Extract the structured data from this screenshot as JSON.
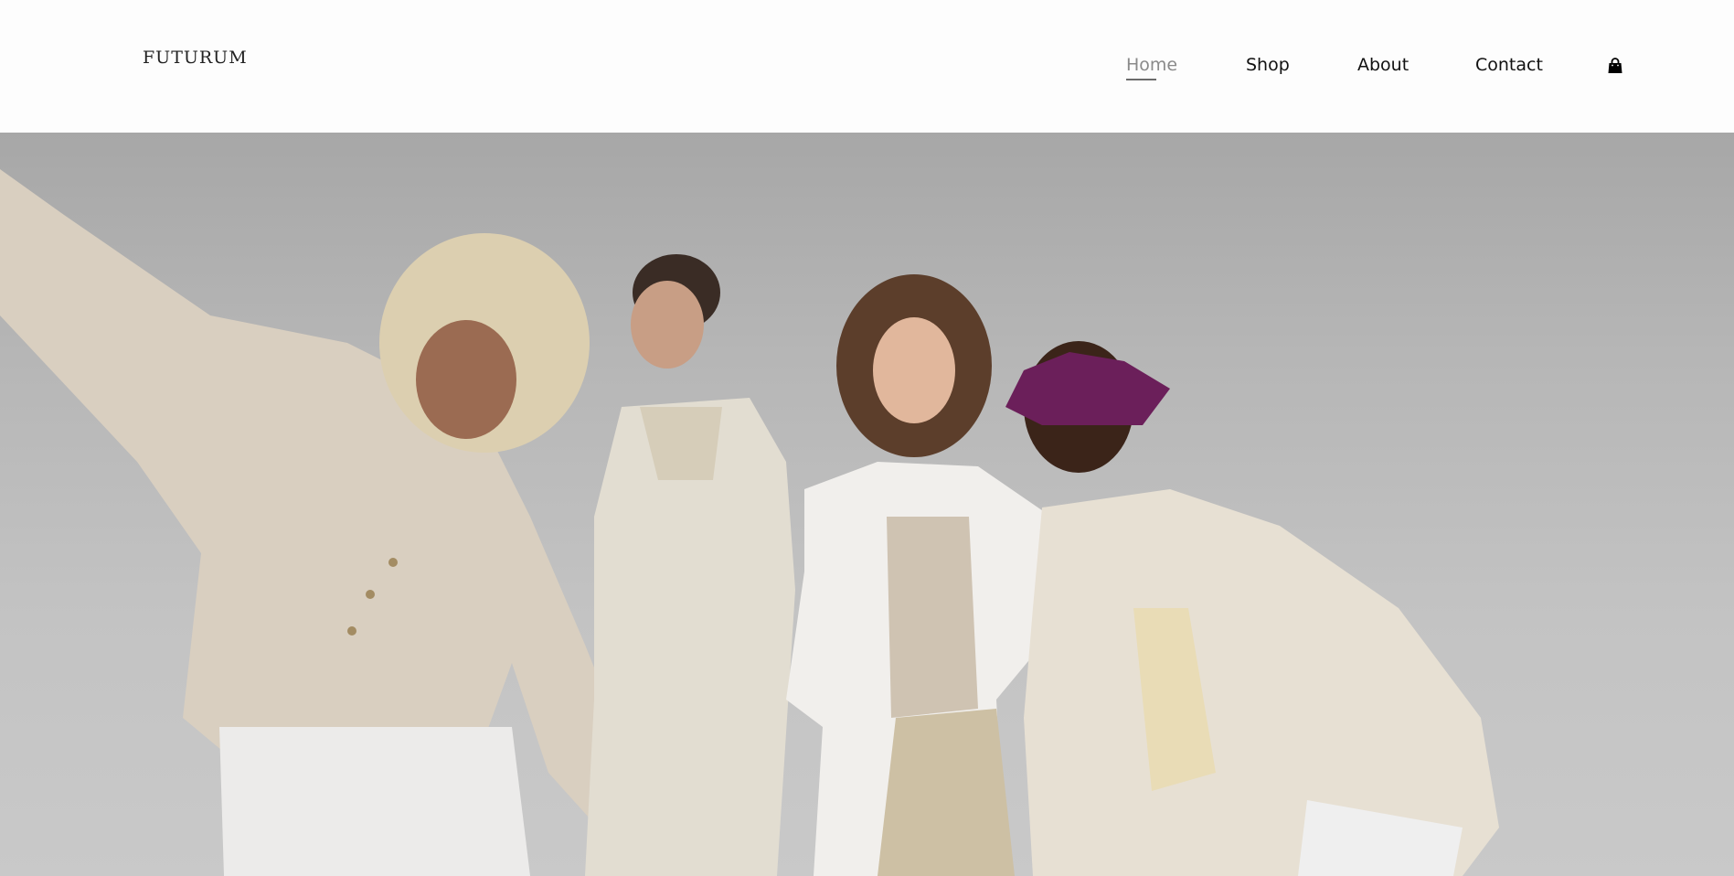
{
  "header": {
    "logo_text": "FUTURUM"
  },
  "nav": {
    "items": [
      {
        "label": "Home",
        "active": true
      },
      {
        "label": "Shop",
        "active": false
      },
      {
        "label": "About",
        "active": false
      },
      {
        "label": "Contact",
        "active": false
      }
    ],
    "cart_icon": "shopping-bag-icon"
  },
  "hero": {
    "image": "four models in cream and white clothing posing against a light grey studio backdrop"
  },
  "colors": {
    "header_bg": "#fdfdfd",
    "hero_bg": "#b4b4b4",
    "nav_text": "#111111",
    "nav_active": "#8a8a8a"
  }
}
